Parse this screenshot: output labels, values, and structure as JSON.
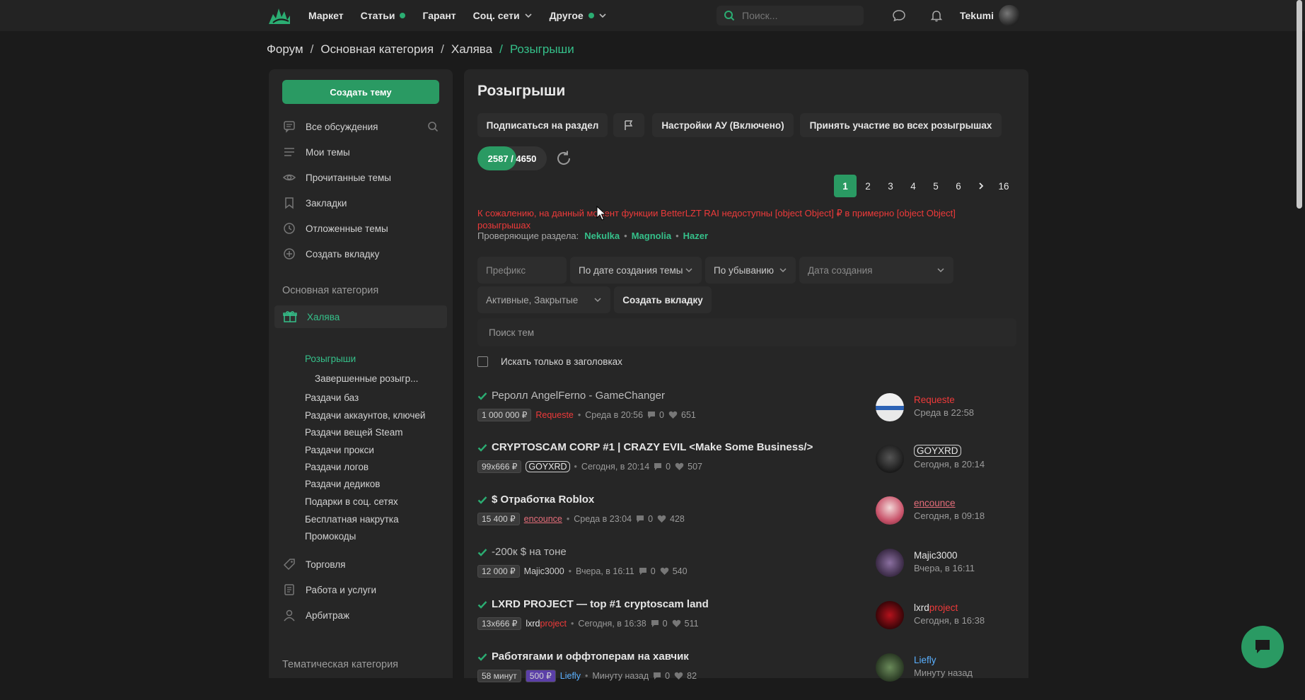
{
  "topbar": {
    "nav": [
      {
        "label": "Маркет",
        "dot": false,
        "chevron": false
      },
      {
        "label": "Статьи",
        "dot": true,
        "chevron": false
      },
      {
        "label": "Гарант",
        "dot": false,
        "chevron": false
      },
      {
        "label": "Соц. сети",
        "dot": false,
        "chevron": true
      },
      {
        "label": "Другое",
        "dot": true,
        "chevron": true
      }
    ],
    "search_placeholder": "Поиск...",
    "username": "Tekumi"
  },
  "breadcrumb": [
    "Форум",
    "Основная категория",
    "Халява",
    "Розыгрыши"
  ],
  "sidebar": {
    "create_button": "Создать тему",
    "items": [
      {
        "label": "Все обсуждения",
        "icon": "chat-icon"
      },
      {
        "label": "Мои темы",
        "icon": "list-icon"
      },
      {
        "label": "Прочитанные темы",
        "icon": "eye-icon"
      },
      {
        "label": "Закладки",
        "icon": "bookmark-icon"
      },
      {
        "label": "Отложенные темы",
        "icon": "clock-icon"
      },
      {
        "label": "Создать вкладку",
        "icon": "plus-circle-icon"
      }
    ],
    "main_category": "Основная категория",
    "active_item": "Халява",
    "sub_items": [
      "Розыгрыши",
      "Завершенные розыгр...",
      "Раздачи баз",
      "Раздачи аккаунтов, ключей",
      "Раздачи вещей Steam",
      "Раздачи прокси",
      "Раздачи логов",
      "Раздачи дедиков",
      "Подарки в соц. сетях",
      "Бесплатная накрутка",
      "Промокоды"
    ],
    "other_items": [
      {
        "label": "Торговля",
        "icon": "tag-icon"
      },
      {
        "label": "Работа и услуги",
        "icon": "document-icon"
      },
      {
        "label": "Арбитраж",
        "icon": "user-icon"
      }
    ],
    "thematic_category": "Тематическая категория"
  },
  "main": {
    "title": "Розыгрыши",
    "buttons": {
      "subscribe": "Подписаться на раздел",
      "settings": "Настройки АУ (Включено)",
      "join_all": "Принять участие во всех розыгрышах"
    },
    "progress": {
      "text": "2587 / 4650",
      "current": 2587,
      "total": 4650
    },
    "pagination": {
      "pages": [
        "1",
        "2",
        "3",
        "4",
        "5",
        "6"
      ],
      "next": "›",
      "last": "16",
      "active": "1"
    },
    "warning": "К сожалению, на данный момент функции BetterLZT RAI недоступны [object Object] ₽ в примерно [object Object] розыгрышах",
    "checkers_label": "Проверяющие раздела:",
    "checkers": [
      "Nekulka",
      "Magnolia",
      "Hazer"
    ],
    "filters": {
      "prefix": "Префикс",
      "sort": "По дате создания темы",
      "order": "По убыванию",
      "date": "Дата создания",
      "state": "Активные, Закрытые",
      "create_tab": "Создать вкладку"
    },
    "search_placeholder": "Поиск тем",
    "titles_only": "Искать только в заголовках"
  },
  "threads": [
    {
      "title": "Реролл AngelFerno - GameChanger",
      "read": true,
      "price": "1 000 000 ₽",
      "author": "Requeste",
      "time": "Среда в 20:56",
      "replies": "0",
      "likes": "651",
      "last_author": "Requeste",
      "last_time": "Среда в 22:58"
    },
    {
      "title": "CRYPTOSCAM CORP #1 | CRAZY EVIL <Make Some Business/>",
      "read": false,
      "price": "99x666 ₽",
      "author": "GOYXRD",
      "time": "Сегодня, в 20:14",
      "replies": "0",
      "likes": "507",
      "last_author": "GOYXRD",
      "last_time": "Сегодня, в 20:14"
    },
    {
      "title": "$ Отработка Roblox",
      "read": false,
      "price": "15 400 ₽",
      "author": "encounce",
      "time": "Среда в 23:04",
      "replies": "0",
      "likes": "428",
      "last_author": "encounce",
      "last_time": "Сегодня, в 09:18"
    },
    {
      "title": "-200к $ на тоне",
      "read": true,
      "price": "12 000 ₽",
      "author": "Majic3000",
      "time": "Вчера, в 16:11",
      "replies": "0",
      "likes": "540",
      "last_author": "Majic3000",
      "last_time": "Вчера, в 16:11"
    },
    {
      "title": "LXRD PROJECT — top #1 cryptoscam land",
      "read": false,
      "price": "13x666 ₽",
      "author_a": "lxrd",
      "author_b": "project",
      "time": "Сегодня, в 16:38",
      "replies": "0",
      "likes": "511",
      "last_author_a": "lxrd",
      "last_author_b": "project",
      "last_time": "Сегодня, в 16:38"
    },
    {
      "title": "Работягами и оффтоперам на хавчик",
      "read": false,
      "price": "58 минут",
      "price2": "500 ₽",
      "author": "Liefly",
      "time": "Минуту назад",
      "replies": "0",
      "likes": "82",
      "last_author": "Liefly",
      "last_time": "Минуту назад"
    }
  ],
  "colors": {
    "accent": "#2a9a63",
    "green_text": "#35c08a",
    "red": "#ee3a3a",
    "bg": "#1b1b1b",
    "panel": "#262626"
  }
}
